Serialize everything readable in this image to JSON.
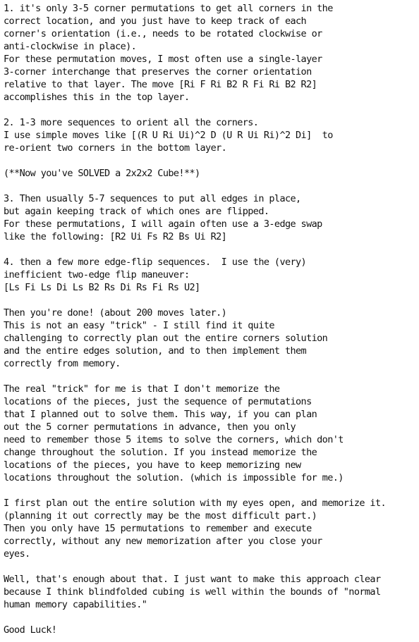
{
  "lines": [
    "1. it's only 3-5 corner permutations to get all corners in the",
    "correct location, and you just have to keep track of each",
    "corner's orientation (i.e., needs to be rotated clockwise or",
    "anti-clockwise in place).",
    "For these permutation moves, I most often use a single-layer",
    "3-corner interchange that preserves the corner orientation",
    "relative to that layer. The move [Ri F Ri B2 R Fi Ri B2 R2]",
    "accomplishes this in the top layer.",
    "",
    "2. 1-3 more sequences to orient all the corners.",
    "I use simple moves like [(R U Ri Ui)^2 D (U R Ui Ri)^2 Di]  to",
    "re-orient two corners in the bottom layer.",
    "",
    "(**Now you've SOLVED a 2x2x2 Cube!**)",
    "",
    "3. Then usually 5-7 sequences to put all edges in place,",
    "but again keeping track of which ones are flipped.",
    "For these permutations, I will again often use a 3-edge swap",
    "like the following: [R2 Ui Fs R2 Bs Ui R2]",
    "",
    "4. then a few more edge-flip sequences.  I use the (very)",
    "inefficient two-edge flip maneuver:",
    "[Ls Fi Ls Di Ls B2 Rs Di Rs Fi Rs U2]",
    "",
    "Then you're done! (about 200 moves later.)",
    "This is not an easy \"trick\" - I still find it quite",
    "challenging to correctly plan out the entire corners solution",
    "and the entire edges solution, and to then implement them",
    "correctly from memory.",
    "",
    "The real \"trick\" for me is that I don't memorize the",
    "locations of the pieces, just the sequence of permutations",
    "that I planned out to solve them. This way, if you can plan",
    "out the 5 corner permutations in advance, then you only",
    "need to remember those 5 items to solve the corners, which don't",
    "change throughout the solution. If you instead memorize the",
    "locations of the pieces, you have to keep memorizing new",
    "locations throughout the solution. (which is impossible for me.)",
    "",
    "I first plan out the entire solution with my eyes open, and memorize it.",
    "(planning it out correctly may be the most difficult part.)",
    "Then you only have 15 permutations to remember and execute",
    "correctly, without any new memorization after you close your",
    "eyes.",
    "",
    "Well, that's enough about that. I just want to make this approach clear",
    "because I think blindfolded cubing is well within the bounds of \"normal",
    "human memory capabilities.\"",
    "",
    "Good Luck!"
  ]
}
